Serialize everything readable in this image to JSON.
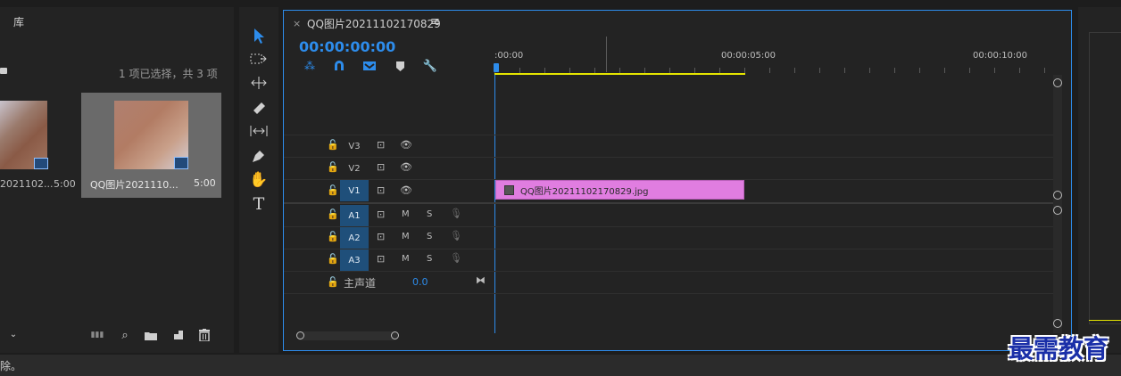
{
  "project": {
    "title": "库",
    "selection_text": "1 项已选择，共 3 项",
    "items": [
      {
        "name": "2021102...",
        "duration": "5:00"
      },
      {
        "name": "QQ图片2021110...",
        "duration": "5:00"
      }
    ]
  },
  "timeline": {
    "close": "×",
    "tab_title": "QQ图片20211102170829",
    "menu": "≡",
    "timecode": "00:00:00:00",
    "ruler": [
      ":00:00",
      "00:00:05:00",
      "00:00:10:00"
    ],
    "tracks_video": [
      {
        "label": "V3",
        "target": false
      },
      {
        "label": "V2",
        "target": false
      },
      {
        "label": "V1",
        "target": true
      }
    ],
    "tracks_audio": [
      {
        "label": "A1",
        "m": "M",
        "s": "S"
      },
      {
        "label": "A2",
        "m": "M",
        "s": "S"
      },
      {
        "label": "A3",
        "m": "M",
        "s": "S"
      }
    ],
    "master": {
      "label": "主声道",
      "value": "0.0"
    },
    "clip": {
      "name": "QQ图片20211102170829.jpg",
      "color": "#e07de0"
    }
  },
  "status": {
    "text": "除。"
  },
  "watermark": "最需教育",
  "colors": {
    "accent": "#2d8ceb",
    "clip": "#e07de0",
    "workarea": "#e5e500"
  }
}
